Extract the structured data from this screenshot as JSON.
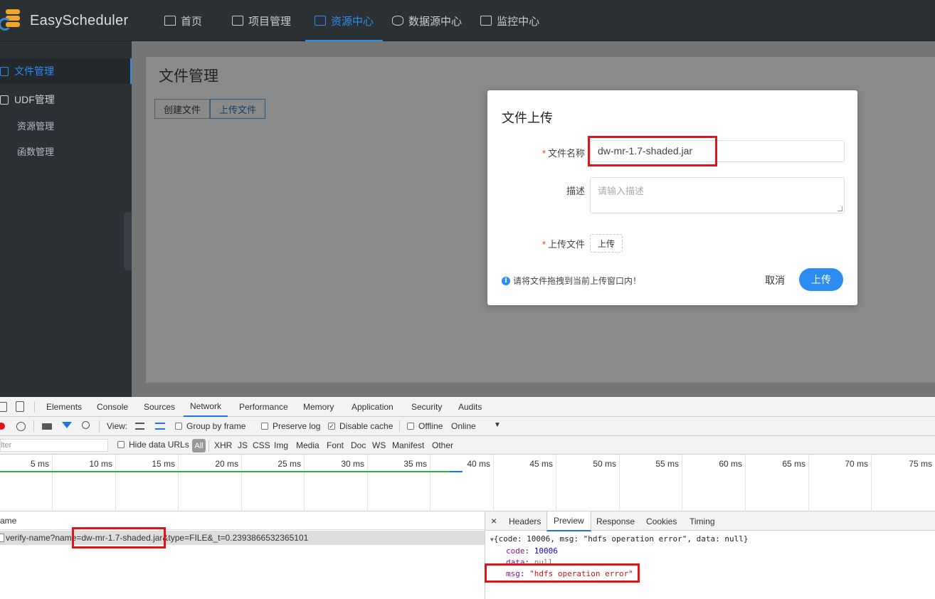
{
  "app": {
    "logo_text": "EasyScheduler"
  },
  "nav": {
    "items": [
      {
        "label": "首页"
      },
      {
        "label": "项目管理"
      },
      {
        "label": "资源中心"
      },
      {
        "label": "数据源中心"
      },
      {
        "label": "监控中心"
      }
    ],
    "active_index": 2
  },
  "sidebar": {
    "items": [
      {
        "label": "文件管理"
      },
      {
        "label": "UDF管理"
      },
      {
        "label": "资源管理"
      },
      {
        "label": "函数管理"
      }
    ]
  },
  "main": {
    "title": "文件管理",
    "create_button": "创建文件",
    "upload_button": "上传文件"
  },
  "modal": {
    "title": "文件上传",
    "filename_label": "文件名称",
    "filename_value": "dw-mr-1.7-shaded.jar",
    "required_mark": "*",
    "description_label": "描述",
    "description_placeholder": "请输入描述",
    "upload_label": "上传文件",
    "upload_button": "上传",
    "hint": "请将文件拖拽到当前上传窗口内！",
    "info_glyph": "i",
    "cancel": "取消",
    "confirm": "上传"
  },
  "devtools": {
    "tabs": [
      "Elements",
      "Console",
      "Sources",
      "Network",
      "Performance",
      "Memory",
      "Application",
      "Security",
      "Audits"
    ],
    "active_tab": "Network",
    "toolbar": {
      "view_label": "View:",
      "group_by_frame": "Group by frame",
      "preserve_log": "Preserve log",
      "disable_cache": "Disable cache",
      "disable_cache_checked": true,
      "offline": "Offline",
      "throttle": "Online",
      "dropdown_glyph": "▼"
    },
    "filterbar": {
      "filter_placeholder": "lter",
      "hide_data_urls": "Hide data URLs",
      "all": "All",
      "types": [
        "XHR",
        "JS",
        "CSS",
        "Img",
        "Media",
        "Font",
        "Doc",
        "WS",
        "Manifest",
        "Other"
      ]
    },
    "timeline_ticks": [
      "5 ms",
      "10 ms",
      "15 ms",
      "20 ms",
      "25 ms",
      "30 ms",
      "35 ms",
      "40 ms",
      "45 ms",
      "50 ms",
      "55 ms",
      "60 ms",
      "65 ms",
      "70 ms",
      "75 ms"
    ],
    "requests": {
      "header": "ame",
      "rows": [
        {
          "name": "verify-name?name=dw-mr-1.7-shaded.jar&type=FILE&_t=0.2393866532365101"
        }
      ]
    },
    "detail": {
      "close_glyph": "×",
      "tabs": [
        "Headers",
        "Preview",
        "Response",
        "Cookies",
        "Timing"
      ],
      "active_tab": "Preview",
      "preview": {
        "summary": "{code: 10006, msg: \"hdfs operation error\", data: null}",
        "toggle": "▼",
        "code_key": "code",
        "code_value": "10006",
        "data_key": "data",
        "data_value": "null",
        "msg_key": "msg",
        "msg_value": "\"hdfs operation error\""
      }
    }
  },
  "colors": {
    "accent": "#2d8cf0",
    "highlight_box": "#e0151b",
    "dark_bg": "#2b3035"
  }
}
